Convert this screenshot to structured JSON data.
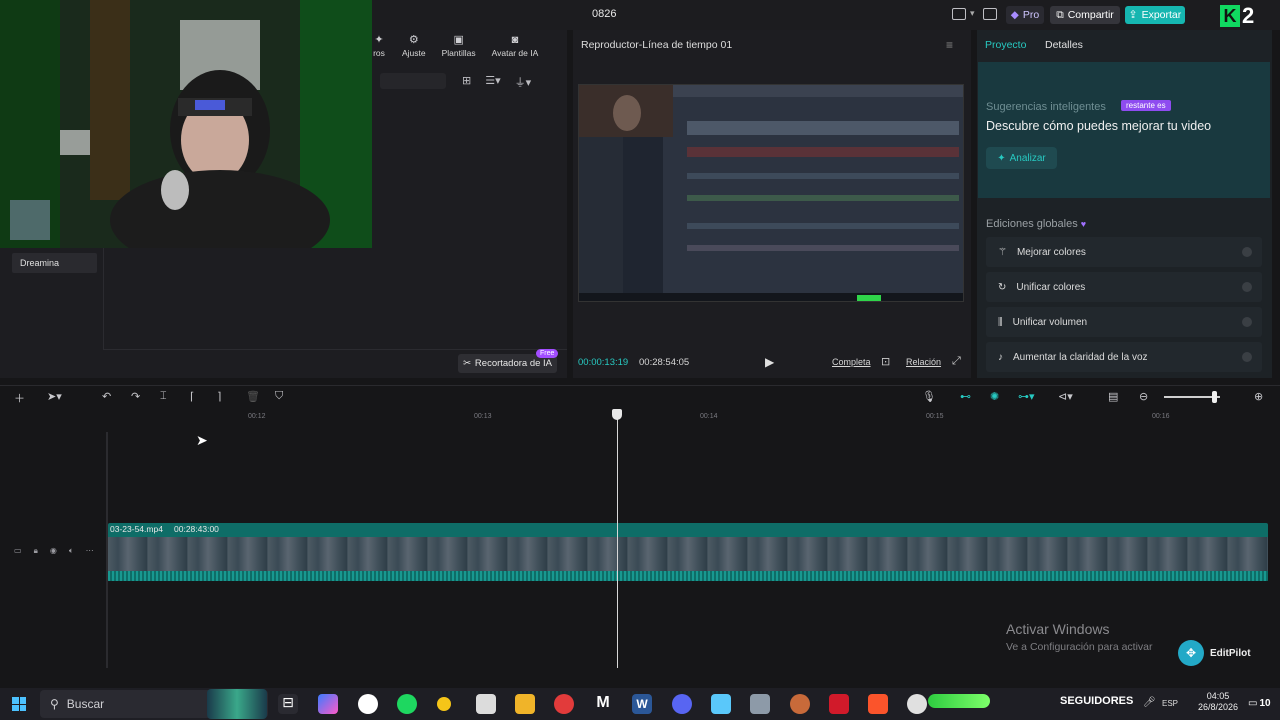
{
  "titlebar": {
    "project_name": "0826",
    "pro_label": "Pro",
    "share_label": "Compartir",
    "export_label": "Exportar",
    "overlay_label": "2"
  },
  "media_panel": {
    "tabs": [
      {
        "label": "ros",
        "icon": "effects-icon"
      },
      {
        "label": "Ajuste",
        "icon": "sliders-icon"
      },
      {
        "label": "Plantillas",
        "icon": "templates-icon"
      },
      {
        "label": "Avatar de IA",
        "icon": "avatar-icon"
      }
    ],
    "folder": "Dreamina",
    "ai_cropper_label": "Recortadora de IA",
    "free_badge": "Free"
  },
  "player": {
    "title": "Reproductor-Línea de tiempo 01",
    "current_time": "00:00:13:19",
    "total_time": "00:28:54:05",
    "quality_label": "Completa",
    "ratio_label": "Relación"
  },
  "right_panel": {
    "tab_project": "Proyecto",
    "tab_details": "Detalles",
    "suggest_title": "Sugerencias inteligentes",
    "suggest_badge": "restante es",
    "suggest_headline": "Descubre cómo puedes mejorar tu video",
    "analyze_label": "Analizar",
    "global_title": "Ediciones globales",
    "global_items": [
      {
        "label": "Mejorar colores",
        "icon": "magic-wand-icon"
      },
      {
        "label": "Unificar colores",
        "icon": "color-sync-icon"
      },
      {
        "label": "Unificar volumen",
        "icon": "volume-bars-icon"
      },
      {
        "label": "Aumentar la claridad de la voz",
        "icon": "voice-icon"
      }
    ]
  },
  "timeline": {
    "ruler_labels": [
      "00:12",
      "00:13",
      "00:14",
      "00:15",
      "00:16"
    ],
    "clip_name": "03-23-54.mp4",
    "clip_duration": "00:28:43:00"
  },
  "watermark": {
    "line1": "Activar Windows",
    "line2": "Ve a Configuración para activar"
  },
  "editpilot_label": "EditPilot",
  "taskbar": {
    "search_placeholder": "Buscar",
    "followers_label": "SEGUIDORES",
    "lang": "ESP",
    "time": "04:05",
    "date": "26/8/2026",
    "notif_count": "10"
  },
  "colors": {
    "accent": "#27c9c1",
    "export": "#16b6b0",
    "clip": "#0e6d67",
    "badge": "#8e4cf0"
  }
}
